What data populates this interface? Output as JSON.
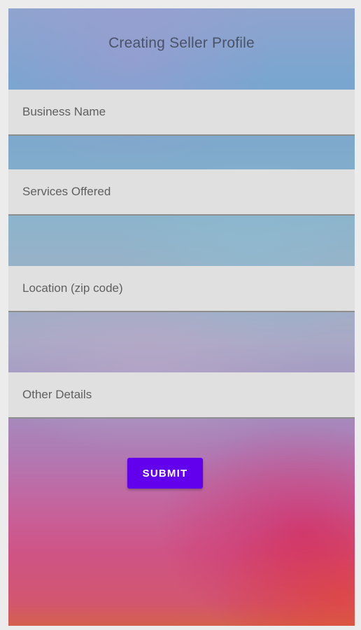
{
  "screen": {
    "title": "Creating Seller Profile"
  },
  "form": {
    "fields": [
      {
        "placeholder": "Business Name",
        "value": ""
      },
      {
        "placeholder": "Services Offered",
        "value": ""
      },
      {
        "placeholder": "Location (zip code)",
        "value": ""
      },
      {
        "placeholder": "Other Details",
        "value": ""
      }
    ],
    "submit_label": "SUBMIT"
  },
  "colors": {
    "accent": "#6200ee",
    "field_background": "#e0e0e0",
    "title_text": "#4a5366"
  }
}
